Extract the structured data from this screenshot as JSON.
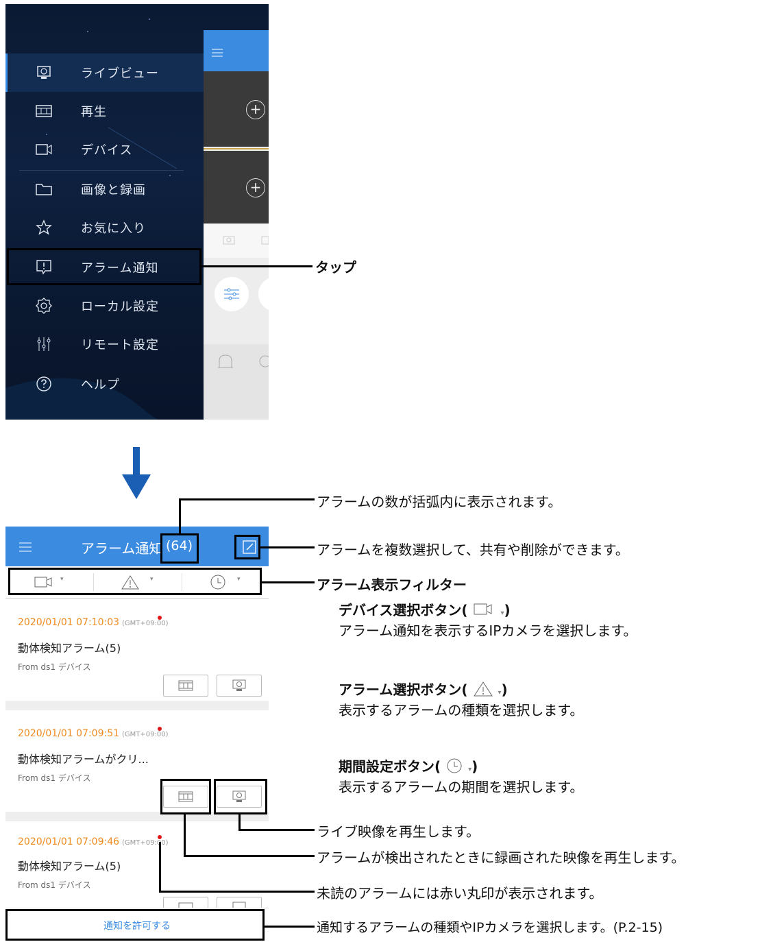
{
  "menu": {
    "items": [
      {
        "label": "ライブビュー",
        "icon": "monitor-icon"
      },
      {
        "label": "再生",
        "icon": "film-icon"
      },
      {
        "label": "デバイス",
        "icon": "camera-icon"
      },
      {
        "label": "画像と録画",
        "icon": "folder-icon"
      },
      {
        "label": "お気に入り",
        "icon": "star-icon"
      },
      {
        "label": "アラーム通知",
        "icon": "alarm-icon"
      },
      {
        "label": "ローカル設定",
        "icon": "gear-icon"
      },
      {
        "label": "リモート設定",
        "icon": "sliders-icon"
      },
      {
        "label": "ヘルプ",
        "icon": "help-icon"
      }
    ]
  },
  "alarm_screen": {
    "title": "アラーム通知",
    "count": "(64)",
    "allow_button": "通知を許可する",
    "cards": [
      {
        "time": "2020/01/01 07:10:03",
        "tz": "(GMT+09:00)",
        "title": "動体検知アラーム(5)",
        "from": "From ds1 デバイス"
      },
      {
        "time": "2020/01/01 07:09:51",
        "tz": "(GMT+09:00)",
        "title": "動体検知アラームがクリ...",
        "from": "From ds1 デバイス"
      },
      {
        "time": "2020/01/01 07:09:46",
        "tz": "(GMT+09:00)",
        "title": "動体検知アラーム(5)",
        "from": "From ds1 デバイス"
      }
    ]
  },
  "annotations": {
    "tap": "タップ",
    "count_note": "アラームの数が括弧内に表示されます。",
    "edit_note": "アラームを複数選択して、共有や削除ができます。",
    "filter_title": "アラーム表示フィルター",
    "device_title_pre": "デバイス選択ボタン(",
    "device_desc": "アラーム通知を表示するIPカメラを選択します。",
    "alarm_title_pre": "アラーム選択ボタン(",
    "alarm_desc": "表示するアラームの種類を選択します。",
    "period_title_pre": "期間設定ボタン(",
    "period_desc": "表示するアラームの期間を選択します。",
    "close_paren": ")",
    "live_note": "ライブ映像を再生します。",
    "playback_note": "アラームが検出されたときに録画された映像を再生します。",
    "unread_note": "未読のアラームには赤い丸印が表示されます。",
    "allow_note": "通知するアラームの種類やIPカメラを選択します。(P.2-15)"
  }
}
